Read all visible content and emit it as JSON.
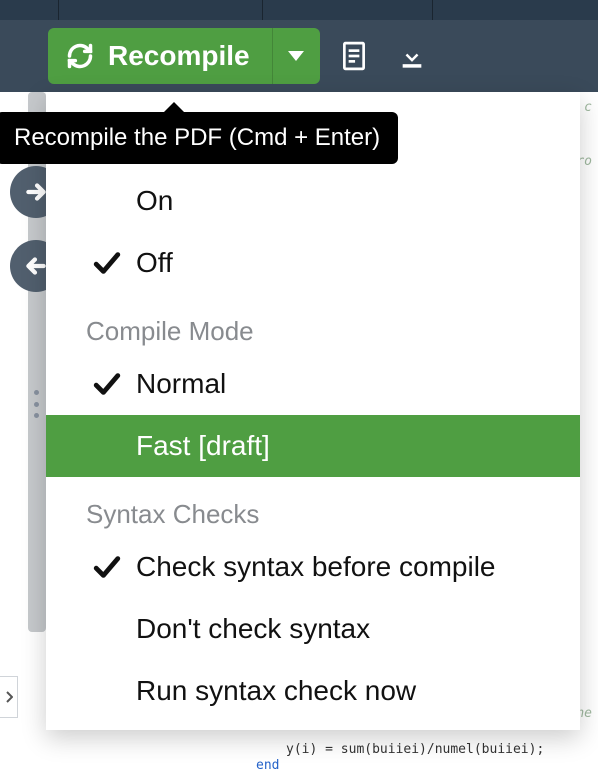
{
  "toolbar": {
    "recompile_label": "Recompile",
    "tooltip": "Recompile the PDF (Cmd + Enter)"
  },
  "dropdown": {
    "sections": {
      "autocompile": {
        "on_label": "On",
        "off_label": "Off",
        "checked": "off"
      },
      "compile_mode": {
        "header": "Compile Mode",
        "normal_label": "Normal",
        "fast_label": "Fast [draft]",
        "checked": "normal",
        "highlighted": "fast"
      },
      "syntax": {
        "header": "Syntax Checks",
        "check_label": "Check syntax before compile",
        "dont_label": "Don't check syntax",
        "run_label": "Run syntax check now",
        "checked": "check"
      }
    }
  },
  "code_fragments": {
    "frag1": "e c",
    "frag2": "pro",
    "frag3": "he",
    "frag4": "y(i) = sum(buiiei)/numel(buiiei);",
    "frag5": "end"
  },
  "icons": {
    "recompile": "refresh-icon",
    "logs": "document-icon",
    "download": "download-icon",
    "caret": "caret-down-icon",
    "nav_forward": "arrow-right-icon",
    "nav_back": "arrow-left-icon"
  },
  "colors": {
    "accent": "#4f9e42",
    "toolbar_bg": "#3a4a5a",
    "topbar_bg": "#2a3b4c",
    "tooltip_bg": "#000000"
  }
}
